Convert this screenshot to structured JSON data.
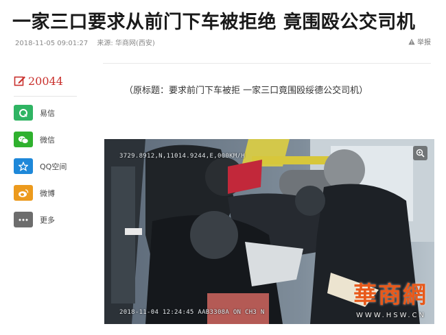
{
  "article": {
    "title": "一家三口要求从前门下车被拒绝 竟围殴公交司机",
    "datetime": "2018-11-05 09:01:27",
    "source": "来源: 华商网(西安)",
    "report_label": "举报",
    "subtitle": "（原标题：要求前门下车被拒 一家三口竟围殴绥德公交司机）"
  },
  "share": {
    "count": "20044",
    "items": [
      {
        "label": "易信",
        "color": "#2fb463",
        "icon": "yixin-icon"
      },
      {
        "label": "微信",
        "color": "#2fb12e",
        "icon": "wechat-icon"
      },
      {
        "label": "QQ空间",
        "color": "#1e88d9",
        "icon": "qzone-icon"
      },
      {
        "label": "微博",
        "color": "#ec9a1d",
        "icon": "weibo-icon"
      },
      {
        "label": "更多",
        "color": "#6d6d6d",
        "icon": "more-icon"
      }
    ]
  },
  "photo": {
    "osd_top": "3729.8912,N,11014.9244,E,000KM/H",
    "osd_bottom": "2018-11-04 12:24:45 AAB3308A ON  CH3 N",
    "watermark_logo": "華商網",
    "watermark_url": "WWW.HSW.CN"
  }
}
